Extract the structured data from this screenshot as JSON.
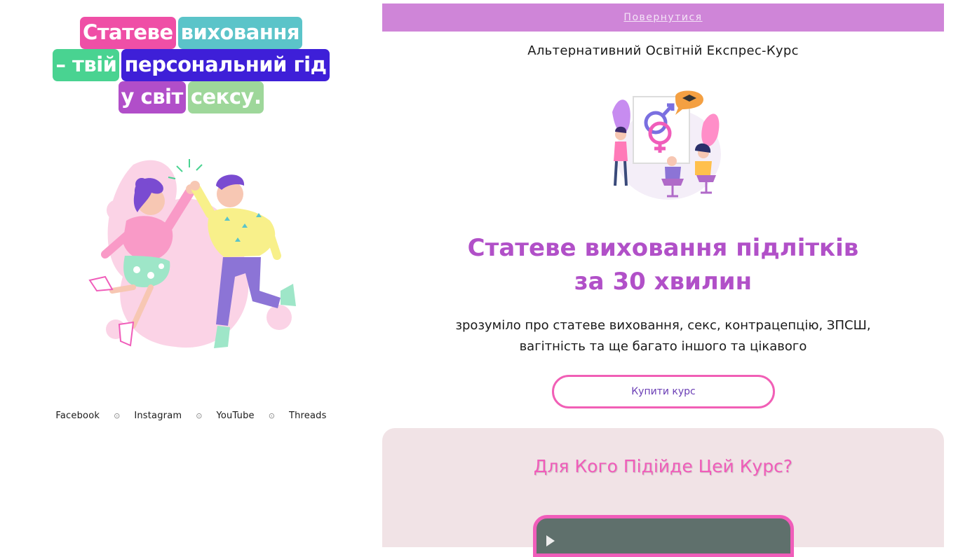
{
  "left": {
    "headline_rows": [
      [
        {
          "text": "Статеве",
          "color": "#ef4fa6"
        },
        {
          "text": "виховання",
          "color": "#5bc4c9"
        }
      ],
      [
        {
          "text": "– твій",
          "color": "#49d391"
        },
        {
          "text": "персональний гід",
          "color": "#3e1fd8"
        }
      ],
      [
        {
          "text": "у світ",
          "color": "#b14ec9"
        },
        {
          "text": "сексу.",
          "color": "#9ed79a"
        }
      ]
    ],
    "social_links": [
      "Facebook",
      "Instagram",
      "YouTube",
      "Threads"
    ],
    "separator_icon": "circle-dot-icon"
  },
  "right": {
    "back_label": "Повернутися",
    "course_subtitle": "Альтернативний Освітній Експрес-Курс",
    "title_line1": "Статеве виховання підлітків",
    "title_line2": "за 30 хвилин",
    "description_line1": "зрозуміло про статеве виховання, секс, контрацепцію, ЗПСШ,",
    "description_line2": "вагітність та ще багато іншого та цікавого",
    "buy_label": "Купити курс",
    "section2_title": "Для Кого Підійде Цей Курс?"
  },
  "colors": {
    "accent_purple": "#b150c8",
    "back_bar": "#cf85d8",
    "pink": "#f15fb6",
    "section_bg": "#f1e3e6"
  }
}
